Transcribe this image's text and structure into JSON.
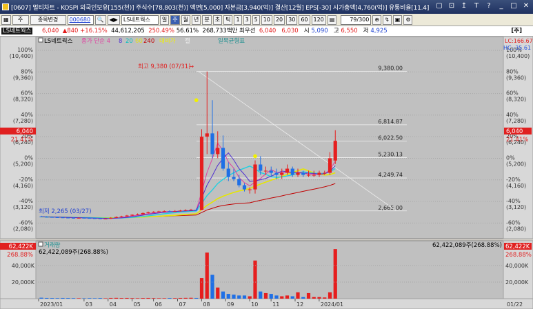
{
  "title": "[0607] 멀티차트 - KOSPI 외국인보유[155(천)] 주식수[78,803(천)] 액면[5,000] 자본금[3,940(억)] 결산[12월] EPS[-30] 시가총액[4,760(억)] 유통비율[11.4]",
  "toolbar": {
    "period_type": "주",
    "code_filter": "종목변경",
    "code": "000680",
    "stock_name": "LS네트웍스",
    "period_buttons": [
      "일",
      "주",
      "월",
      "년",
      "분",
      "초",
      "틱"
    ],
    "active_period": "주",
    "numbers": [
      "1",
      "3",
      "5",
      "10",
      "20",
      "30",
      "60",
      "120"
    ],
    "count": "79/300"
  },
  "info": {
    "name": "LS네트웍스",
    "price": "6,040",
    "change": "840 +16.15%",
    "volume": "44,612,205",
    "vol_ratio": "250.49%",
    "turnover": "56.61%",
    "amount": "268,733백만",
    "best_label": "최우선",
    "bid1": "6,040",
    "bid2": "6,030",
    "open_label": "시",
    "open": "5,090",
    "high_label": "고",
    "high": "6,550",
    "low_label": "저",
    "low": "4,925",
    "corner": "[주]"
  },
  "price_pane": {
    "legend": [
      "LS네트웍스",
      "종가 단순 4",
      "8",
      "20",
      "60",
      "240",
      "대비가",
      "캘"
    ],
    "legend_extra": "일목균형표",
    "lc": "LC:166.67",
    "hc": "HC:-35.61",
    "right_price": "6,040",
    "right_pct": "21.41%",
    "left_price": "6,040",
    "left_pct": "21.41%",
    "annot_high": "최고 9,380 (07/31)",
    "annot_low": "최저 2,265 (03/27)",
    "y_labels": [
      {
        "pct": "100%",
        "price": "(10,400)"
      },
      {
        "pct": "80%",
        "price": "(9,360)"
      },
      {
        "pct": "60%",
        "price": "(8,320)"
      },
      {
        "pct": "40%",
        "price": "(7,280)"
      },
      {
        "pct": "20%",
        "price": "(6,240)"
      },
      {
        "pct": "0%",
        "price": "(5,200)"
      },
      {
        "pct": "-20%",
        "price": "(4,160)"
      },
      {
        "pct": "-40%",
        "price": "(3,120)"
      },
      {
        "pct": "-60%",
        "price": "(2,080)"
      }
    ],
    "fib_levels": [
      "9,380.00",
      "6,814.87",
      "6,022.50",
      "5,230.13",
      "4,249.74",
      "2,665.00"
    ]
  },
  "volume_pane": {
    "legend": "거래량",
    "current": "62,422,089주(268.88%)",
    "current_right": "62,422,089주(268.88%)",
    "badge": "62,422K",
    "pct": "268.88%",
    "y_labels": [
      "40,000K",
      "20,000K"
    ]
  },
  "x_axis": [
    "2023/01",
    "03",
    "04",
    "05",
    "06",
    "07",
    "08",
    "09",
    "10",
    "11",
    "12",
    "2024/01"
  ],
  "x_right": "01/22",
  "chart_data": {
    "type": "candlestick",
    "x": [
      "2023-01-02",
      "2023-01-09",
      "2023-01-16",
      "2023-01-23",
      "2023-01-30",
      "2023-02-06",
      "2023-02-13",
      "2023-02-20",
      "2023-02-27",
      "2023-03-06",
      "2023-03-13",
      "2023-03-20",
      "2023-03-27",
      "2023-04-03",
      "2023-04-10",
      "2023-04-17",
      "2023-04-24",
      "2023-05-01",
      "2023-05-08",
      "2023-05-15",
      "2023-05-22",
      "2023-05-29",
      "2023-06-05",
      "2023-06-12",
      "2023-06-19",
      "2023-06-26",
      "2023-07-03",
      "2023-07-10",
      "2023-07-17",
      "2023-07-24",
      "2023-07-31",
      "2023-08-07",
      "2023-08-14",
      "2023-08-21",
      "2023-08-28",
      "2023-09-04",
      "2023-09-11",
      "2023-09-18",
      "2023-09-25",
      "2023-10-02",
      "2023-10-09",
      "2023-10-16",
      "2023-10-23",
      "2023-10-30",
      "2023-11-06",
      "2023-11-13",
      "2023-11-20",
      "2023-11-27",
      "2023-12-04",
      "2023-12-11",
      "2023-12-18",
      "2023-12-25",
      "2024-01-01",
      "2024-01-08",
      "2024-01-15",
      "2024-01-22"
    ],
    "open": [
      2390,
      2380,
      2370,
      2360,
      2350,
      2340,
      2330,
      2320,
      2330,
      2320,
      2310,
      2300,
      2280,
      2290,
      2330,
      2370,
      2400,
      2440,
      2480,
      2500,
      2560,
      2600,
      2620,
      2640,
      2650,
      2640,
      2650,
      2680,
      2700,
      2720,
      2700,
      6240,
      6400,
      5400,
      5700,
      4700,
      4300,
      4200,
      3900,
      3700,
      3700,
      4900,
      4600,
      4600,
      4500,
      4400,
      4500,
      4700,
      4400,
      4500,
      4400,
      4400,
      4400,
      4500,
      4500,
      5090
    ],
    "close": [
      2380,
      2370,
      2360,
      2350,
      2340,
      2330,
      2320,
      2330,
      2320,
      2310,
      2300,
      2285,
      2290,
      2330,
      2370,
      2400,
      2440,
      2480,
      2500,
      2560,
      2600,
      2620,
      2640,
      2650,
      2640,
      2650,
      2680,
      2700,
      2720,
      2700,
      6240,
      6400,
      5400,
      5700,
      4700,
      4300,
      4200,
      3900,
      3700,
      3700,
      4900,
      4600,
      4600,
      4500,
      4400,
      4500,
      4700,
      4400,
      4500,
      4400,
      4400,
      4400,
      4500,
      4500,
      5200,
      6040
    ],
    "high": [
      2430,
      2410,
      2400,
      2390,
      2380,
      2370,
      2360,
      2360,
      2360,
      2350,
      2340,
      2320,
      2330,
      2360,
      2400,
      2430,
      2470,
      2500,
      2540,
      2590,
      2630,
      2650,
      2670,
      2690,
      2690,
      2700,
      2720,
      2740,
      2760,
      2780,
      6600,
      9380,
      8000,
      6500,
      6300,
      5000,
      4700,
      4400,
      4000,
      3800,
      5100,
      5300,
      4800,
      4800,
      4700,
      4700,
      4900,
      4800,
      4700,
      4600,
      4600,
      4600,
      4600,
      4600,
      5500,
      6550
    ],
    "low": [
      2360,
      2350,
      2340,
      2330,
      2320,
      2310,
      2300,
      2300,
      2300,
      2290,
      2280,
      2265,
      2270,
      2280,
      2320,
      2350,
      2390,
      2420,
      2460,
      2480,
      2540,
      2580,
      2600,
      2620,
      2620,
      2620,
      2630,
      2660,
      2680,
      2690,
      2690,
      5400,
      5200,
      5200,
      4600,
      4100,
      4100,
      3800,
      3600,
      3500,
      3500,
      4400,
      4400,
      4300,
      4200,
      4200,
      4400,
      4300,
      4300,
      4300,
      4300,
      4300,
      4300,
      4400,
      4400,
      4925
    ],
    "volume": [
      1200,
      900,
      800,
      700,
      900,
      800,
      700,
      600,
      500,
      700,
      600,
      800,
      500,
      900,
      1000,
      800,
      900,
      700,
      600,
      800,
      900,
      700,
      600,
      600,
      800,
      700,
      900,
      1000,
      1100,
      900,
      26000,
      58000,
      30000,
      14000,
      9000,
      6000,
      5000,
      4000,
      4000,
      3000,
      48000,
      9000,
      7000,
      6000,
      4000,
      3000,
      4000,
      3000,
      8000,
      2000,
      7000,
      2000,
      2000,
      1500,
      8000,
      62422
    ]
  }
}
